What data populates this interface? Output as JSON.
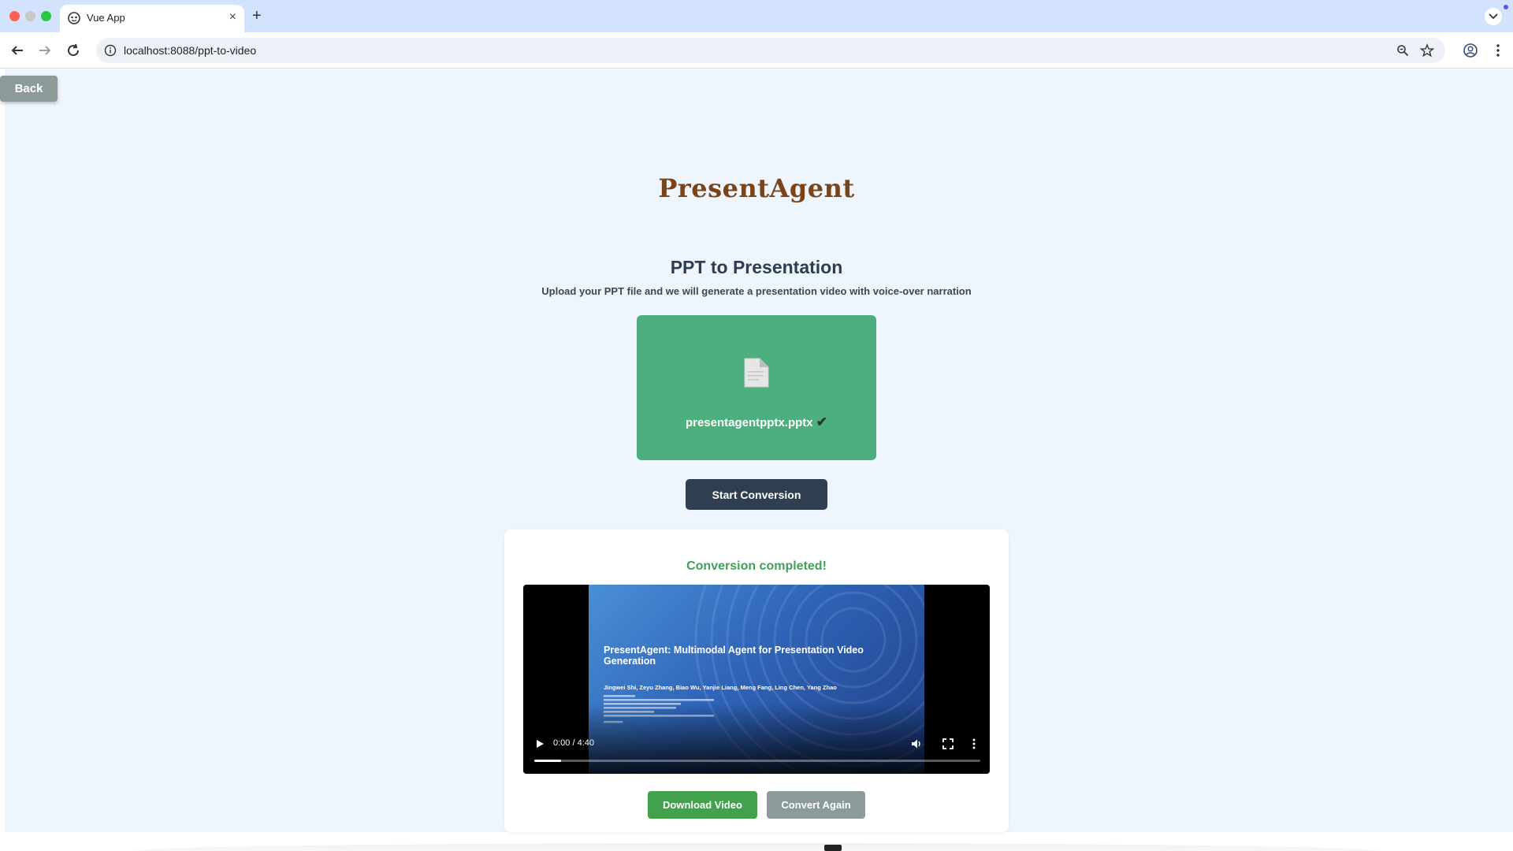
{
  "browser": {
    "tab_title": "Vue App",
    "tab_close": "×",
    "new_tab": "+",
    "url": "localhost:8088/ppt-to-video"
  },
  "page": {
    "back_label": "Back",
    "brand": "PresentAgent",
    "title": "PPT to Presentation",
    "subtitle": "Upload your PPT file and we will generate a presentation video with voice-over narration",
    "upload": {
      "file_name": "presentagentpptx.pptx",
      "check": "✔"
    },
    "start_label": "Start Conversion",
    "result": {
      "status": "Conversion completed!",
      "video": {
        "slide_title": "PresentAgent: Multimodal Agent for Presentation Video Generation",
        "slide_authors": "Jingwei Shi, Zeyu Zhang, Biao Wu, Yanjie Liang, Meng Fang, Ling Chen, Yang Zhao",
        "time": "0:00 / 4:40",
        "progress": 0.06
      },
      "download_label": "Download Video",
      "again_label": "Convert Again"
    }
  },
  "colors": {
    "brand": "#7b4318",
    "upload_box": "#4caf7d",
    "primary_dark": "#2f3e50",
    "success_text": "#3fa15a",
    "download": "#43a04c",
    "secondary": "#8c9a9a",
    "page_bg": "#eef5fd"
  }
}
